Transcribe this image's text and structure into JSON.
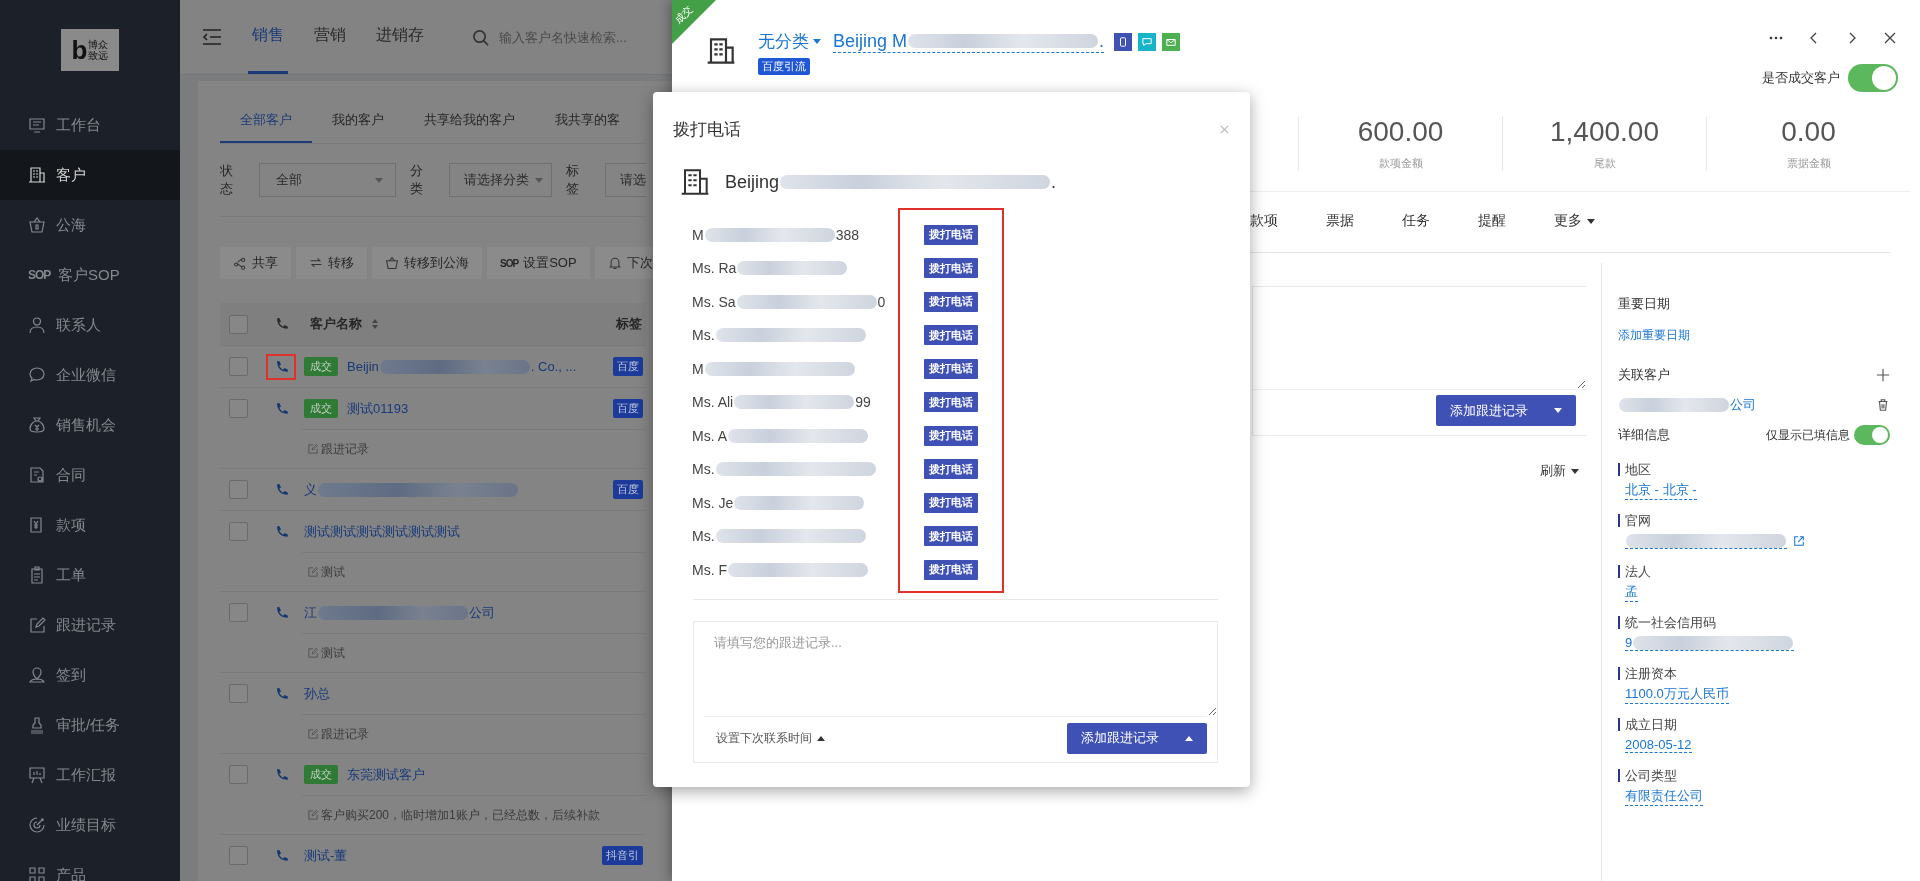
{
  "sidebar": {
    "logo": {
      "letter": "b",
      "text": "博众致远"
    },
    "items": [
      {
        "label": "工作台",
        "selected": false
      },
      {
        "label": "客户",
        "selected": true
      },
      {
        "label": "公海",
        "selected": false
      },
      {
        "label": "客户SOP",
        "selected": false,
        "icon_text": "SOP"
      },
      {
        "label": "联系人",
        "selected": false
      },
      {
        "label": "企业微信",
        "selected": false
      },
      {
        "label": "销售机会",
        "selected": false
      },
      {
        "label": "合同",
        "selected": false
      },
      {
        "label": "款项",
        "selected": false
      },
      {
        "label": "工单",
        "selected": false
      },
      {
        "label": "跟进记录",
        "selected": false
      },
      {
        "label": "签到",
        "selected": false
      },
      {
        "label": "审批/任务",
        "selected": false
      },
      {
        "label": "工作汇报",
        "selected": false
      },
      {
        "label": "业绩目标",
        "selected": false
      },
      {
        "label": "产品",
        "selected": false
      }
    ]
  },
  "top_nav": {
    "tabs": [
      {
        "label": "销售",
        "selected": true
      },
      {
        "label": "营销",
        "selected": false
      },
      {
        "label": "进销存",
        "selected": false
      }
    ],
    "search": {
      "placeholder": "输入客户名快速检索..."
    }
  },
  "customer_tabs": [
    {
      "label": "全部客户",
      "selected": true
    },
    {
      "label": "我的客户",
      "selected": false
    },
    {
      "label": "共享给我的客户",
      "selected": false
    },
    {
      "label": "我共享的客",
      "selected": false
    }
  ],
  "filters": [
    {
      "label": "状态",
      "value": "全部",
      "kind": "select"
    },
    {
      "label": "分类",
      "value": "请选择分类",
      "kind": "dropdown"
    },
    {
      "label": "标签",
      "value": "请选",
      "kind": "cut"
    }
  ],
  "actions": [
    {
      "label": "共享"
    },
    {
      "label": "转移"
    },
    {
      "label": "转移到公海"
    },
    {
      "label": "设置SOP",
      "icon_text": "SOP"
    },
    {
      "label": "下次"
    }
  ],
  "table": {
    "select_all_checked": false,
    "columns": [
      "客户名称",
      "标签"
    ],
    "rows": [
      {
        "checked": false,
        "highlighted": true,
        "status_tag": "成交",
        "name": "Beijin",
        "redacted": true,
        "name_end": ". Co., ...",
        "tag": "百度"
      },
      {
        "checked": false,
        "highlighted": false,
        "status_tag": "成交",
        "name": "测试01193",
        "redacted": false,
        "tag": "百度",
        "note": "跟进记录"
      },
      {
        "checked": false,
        "highlighted": false,
        "name": "义",
        "redacted": true,
        "tag": "百度"
      },
      {
        "checked": false,
        "highlighted": false,
        "name": "测试测试测试测试测试测试",
        "redacted": false,
        "note": "测试"
      },
      {
        "checked": false,
        "highlighted": false,
        "name": "江",
        "redacted": true,
        "name_end": "公司",
        "note": "测试"
      },
      {
        "checked": false,
        "highlighted": false,
        "name": "孙总",
        "redacted": false,
        "note": "跟进记录"
      },
      {
        "checked": false,
        "highlighted": false,
        "status_tag": "成交",
        "name": "东莞测试客户",
        "redacted": false,
        "note": "客户购买200，临时增加1账户，已经总数，后续补款"
      },
      {
        "checked": false,
        "highlighted": false,
        "name": "测试-董",
        "redacted": false,
        "tag": "抖音引"
      }
    ]
  },
  "detail": {
    "ribbon": "成交",
    "category": "无分类",
    "name": "Beijing M",
    "name_end": ".",
    "source_tag": "百度引流",
    "is_deal_label": "是否成交客户",
    "is_deal": true,
    "stats": [
      {
        "value": "600.00",
        "label": "款项金额"
      },
      {
        "value": "1,400.00",
        "label": "尾款"
      },
      {
        "value": "0.00",
        "label": "票据金额"
      }
    ],
    "tabs": [
      {
        "label": "款项",
        "selected": false,
        "kind": "tab"
      },
      {
        "label": "票据",
        "selected": false,
        "kind": "tab"
      },
      {
        "label": "任务",
        "selected": false,
        "kind": "tab"
      },
      {
        "label": "提醒",
        "selected": false,
        "kind": "tab"
      },
      {
        "label": "更多",
        "selected": false,
        "kind": "menu"
      }
    ],
    "follow_up_button": "添加跟进记录",
    "refresh": "刷新",
    "side": {
      "important_dates": {
        "title": "重要日期",
        "link": "添加重要日期"
      },
      "related": {
        "title": "关联客户",
        "value_end": "公司"
      },
      "details": {
        "title": "详细信息",
        "filled_only_label": "仅显示已填信息",
        "filled_only": true,
        "fields": [
          {
            "label": "地区",
            "value": "北京 - 北京 -",
            "redacted": false
          },
          {
            "label": "官网",
            "redacted": true,
            "kind": "link"
          },
          {
            "label": "法人",
            "value": "孟",
            "redacted": false
          },
          {
            "label": "统一社会信用码",
            "value": "9",
            "redacted": true
          },
          {
            "label": "注册资本",
            "value": "1100.0万元人民币",
            "redacted": false
          },
          {
            "label": "成立日期",
            "value": "2008-05-12",
            "redacted": false
          },
          {
            "label": "公司类型",
            "value": "有限责任公司",
            "redacted": false
          }
        ]
      }
    }
  },
  "modal": {
    "title": "拨打电话",
    "company": "Beijing",
    "company_end": ".",
    "call_buttons_highlighted": true,
    "contacts": [
      {
        "name": "M",
        "name_end": "388",
        "call": "拨打电话"
      },
      {
        "name": "Ms. Ra",
        "call": "拨打电话"
      },
      {
        "name": "Ms. Sa",
        "name_end": "0",
        "call": "拨打电话"
      },
      {
        "name": "Ms.",
        "call": "拨打电话"
      },
      {
        "name": "M",
        "call": "拨打电话"
      },
      {
        "name": "Ms. Ali",
        "name_end": "99",
        "call": "拨打电话"
      },
      {
        "name": "Ms. A",
        "call": "拨打电话"
      },
      {
        "name": "Ms.",
        "call": "拨打电话"
      },
      {
        "name": "Ms. Je",
        "call": "拨打电话"
      },
      {
        "name": "Ms.",
        "call": "拨打电话"
      },
      {
        "name": "Ms. F",
        "call": "拨打电话"
      }
    ],
    "note_placeholder": "请填写您的跟进记录...",
    "next_contact": "设置下次联系时间",
    "submit": "添加跟进记录"
  }
}
